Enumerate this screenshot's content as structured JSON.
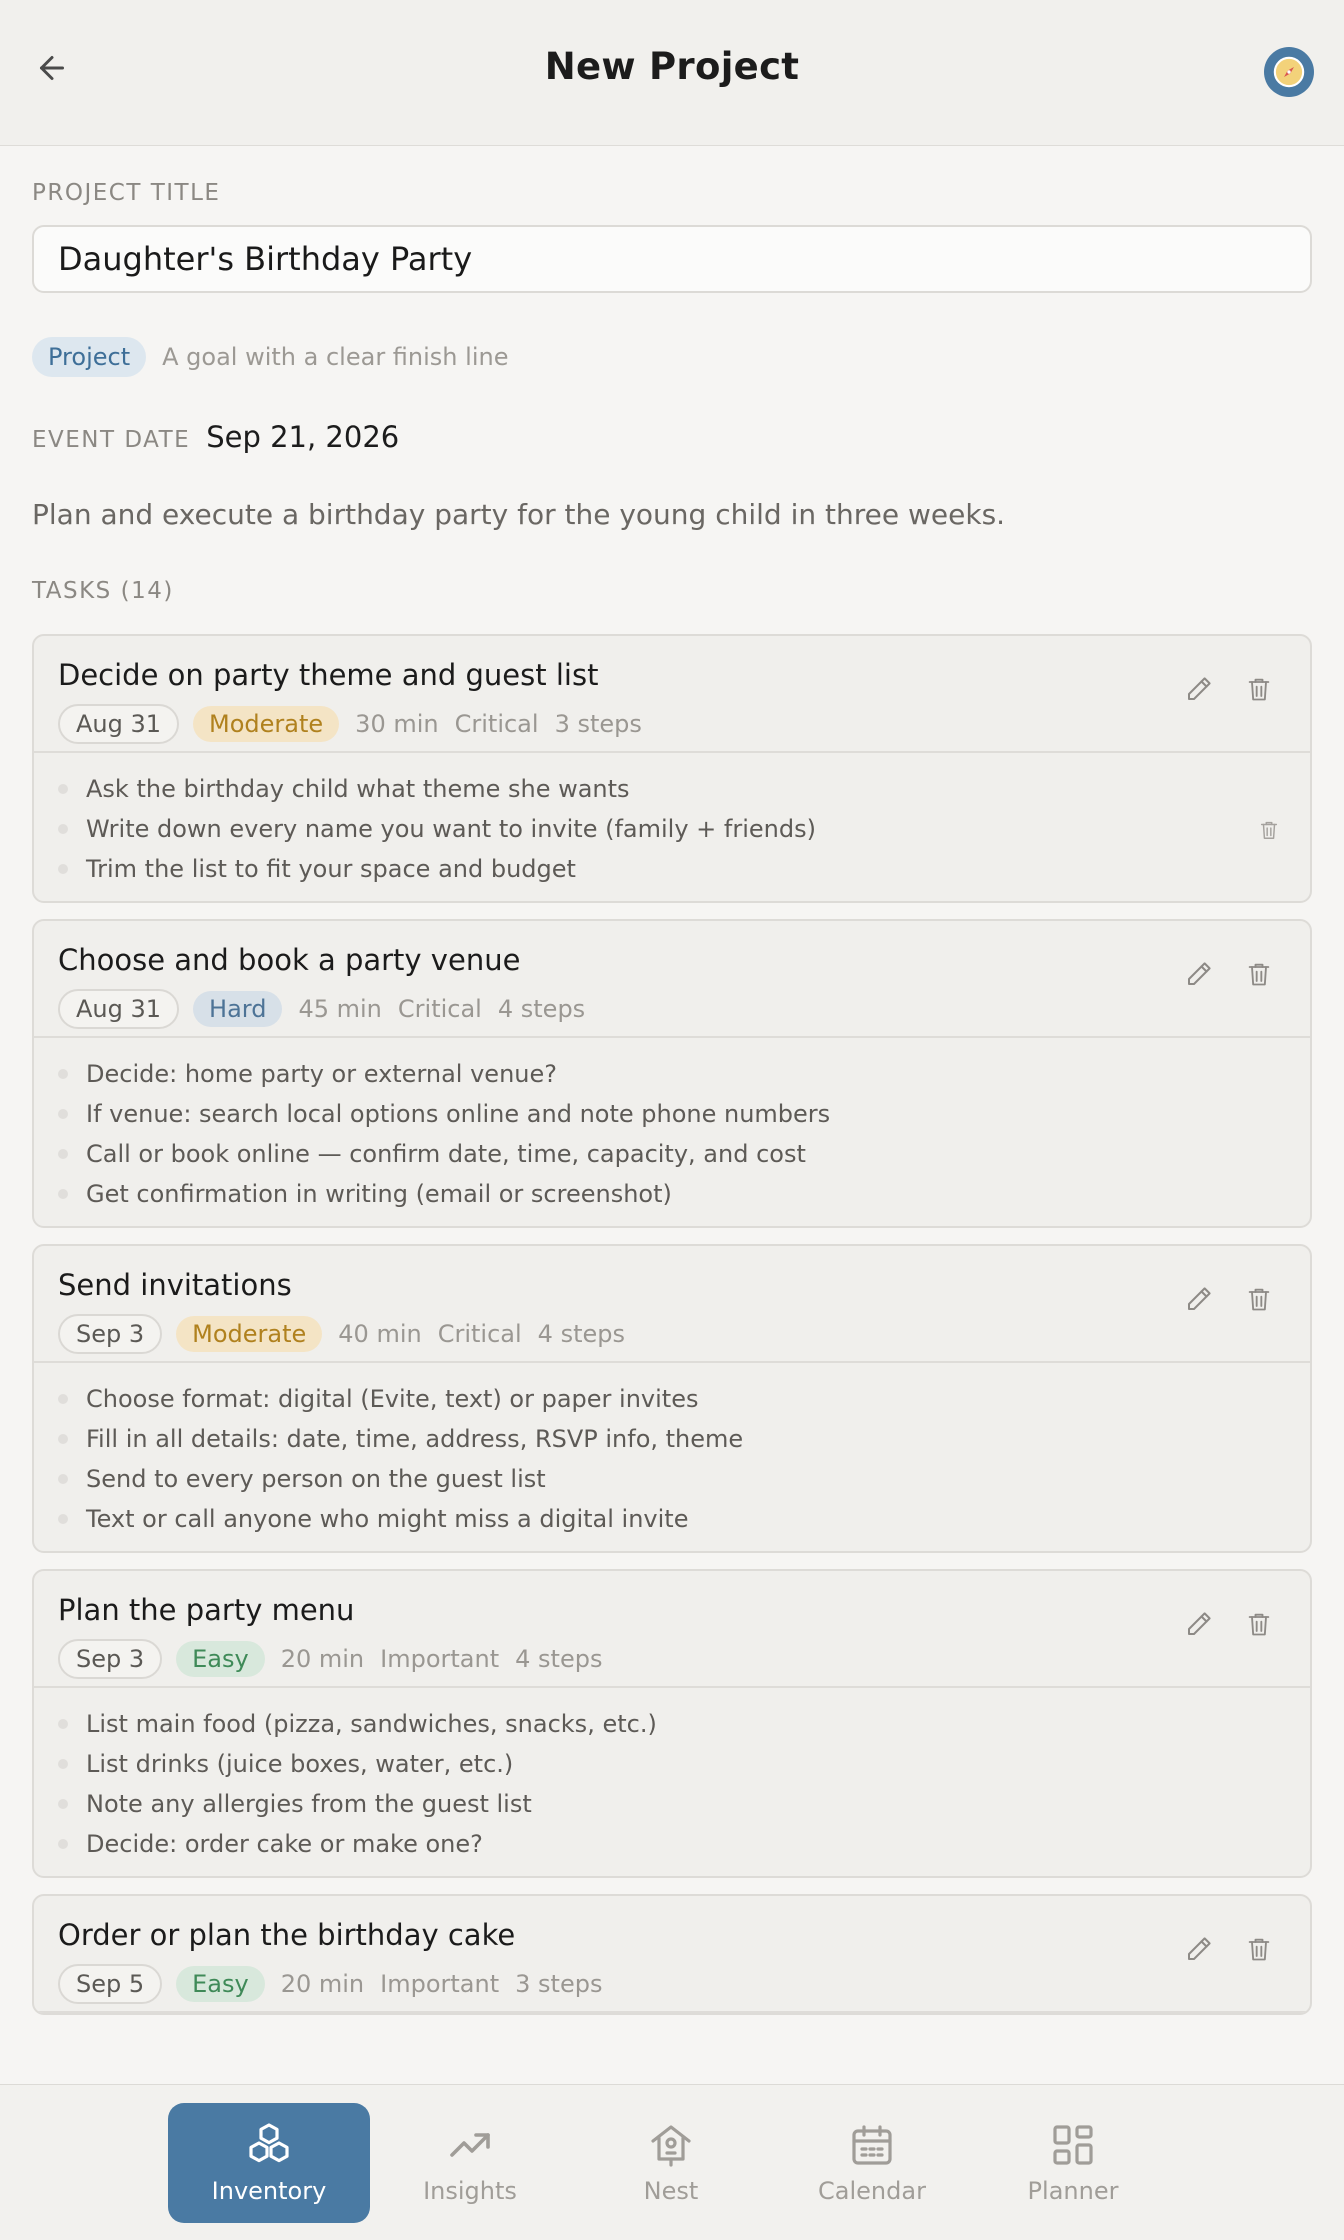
{
  "header": {
    "title": "New Project"
  },
  "form": {
    "title_label": "PROJECT TITLE",
    "title_value": "Daughter's Birthday Party",
    "type_chip": "Project",
    "type_description": "A goal with a clear finish line",
    "event_date_label": "EVENT DATE",
    "event_date": "Sep 21, 2026",
    "description": "Plan and execute a birthday party for the young child in three weeks.",
    "tasks_label": "TASKS (14)"
  },
  "tasks": [
    {
      "title": "Decide on party theme and guest list",
      "date": "Aug 31",
      "difficulty": "Moderate",
      "duration": "30 min",
      "priority": "Critical",
      "steps_count": "3 steps",
      "steps": [
        "Ask the birthday child what theme she wants",
        "Write down every name you want to invite (family + friends)",
        "Trim the list to fit your space and budget"
      ]
    },
    {
      "title": "Choose and book a party venue",
      "date": "Aug 31",
      "difficulty": "Hard",
      "duration": "45 min",
      "priority": "Critical",
      "steps_count": "4 steps",
      "steps": [
        "Decide: home party or external venue?",
        "If venue: search local options online and note phone numbers",
        "Call or book online — confirm date, time, capacity, and cost",
        "Get confirmation in writing (email or screenshot)"
      ]
    },
    {
      "title": "Send invitations",
      "date": "Sep 3",
      "difficulty": "Moderate",
      "duration": "40 min",
      "priority": "Critical",
      "steps_count": "4 steps",
      "steps": [
        "Choose format: digital (Evite, text) or paper invites",
        "Fill in all details: date, time, address, RSVP info, theme",
        "Send to every person on the guest list",
        "Text or call anyone who might miss a digital invite"
      ]
    },
    {
      "title": "Plan the party menu",
      "date": "Sep 3",
      "difficulty": "Easy",
      "duration": "20 min",
      "priority": "Important",
      "steps_count": "4 steps",
      "steps": [
        "List main food (pizza, sandwiches, snacks, etc.)",
        "List drinks (juice boxes, water, etc.)",
        "Note any allergies from the guest list",
        "Decide: order cake or make one?"
      ]
    },
    {
      "title": "Order or plan the birthday cake",
      "date": "Sep 5",
      "difficulty": "Easy",
      "duration": "20 min",
      "priority": "Important",
      "steps_count": "3 steps",
      "steps": []
    }
  ],
  "nav": [
    {
      "label": "Inventory",
      "icon": "cubes-icon",
      "active": true
    },
    {
      "label": "Insights",
      "icon": "trend-icon",
      "active": false
    },
    {
      "label": "Nest",
      "icon": "birdhouse-icon",
      "active": false
    },
    {
      "label": "Calendar",
      "icon": "calendar-icon",
      "active": false
    },
    {
      "label": "Planner",
      "icon": "grid-icon",
      "active": false
    }
  ],
  "colors": {
    "accent": "#4a7aa3",
    "moderate": "#b0811e",
    "hard": "#4d7396",
    "easy": "#3f8a58"
  }
}
